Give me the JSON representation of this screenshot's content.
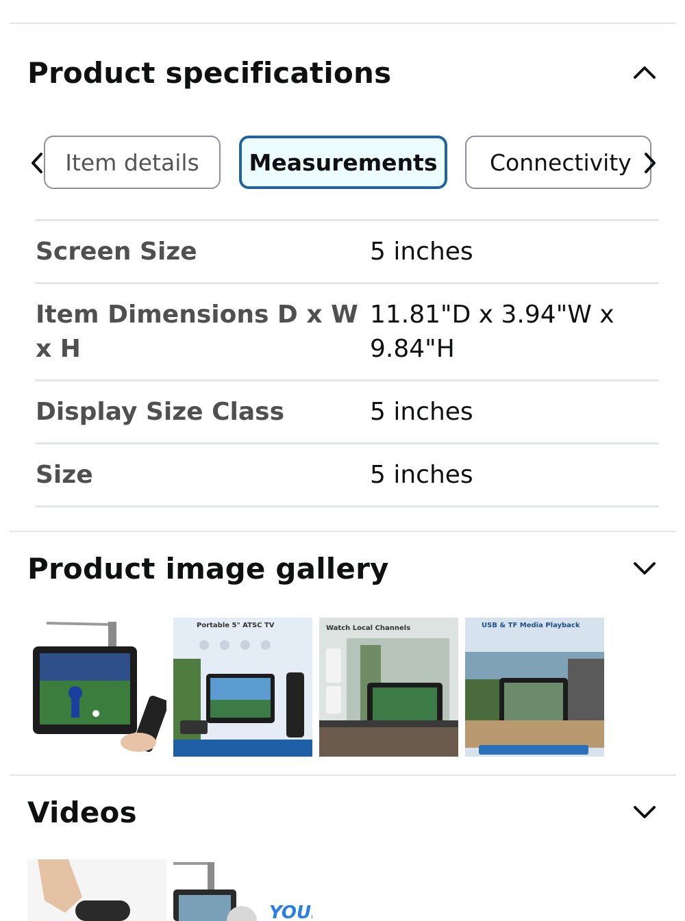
{
  "specs_section": {
    "title": "Product specifications",
    "expanded": true,
    "toggle_icon": "chevron-up-icon"
  },
  "tabs": {
    "prev_icon": "chevron-left-icon",
    "next_icon": "chevron-right-icon",
    "items": [
      {
        "label": "Item details",
        "active": false
      },
      {
        "label": "Measurements",
        "active": true
      },
      {
        "label": "Connectivity",
        "active": false
      }
    ]
  },
  "specs": [
    {
      "label": "Screen Size",
      "value": "5 inches"
    },
    {
      "label": "Item Dimensions D x W x H",
      "value": "11.81\"D x 3.94\"W x 9.84\"H"
    },
    {
      "label": "Display Size Class",
      "value": "5 inches"
    },
    {
      "label": "Size",
      "value": "5 inches"
    }
  ],
  "gallery_section": {
    "title": "Product image gallery",
    "expanded": false,
    "toggle_icon": "chevron-down-icon",
    "images": [
      {
        "caption": ""
      },
      {
        "caption": "Portable 5\" ATSC TV"
      },
      {
        "caption": "Watch Local Channels"
      },
      {
        "caption": "USB & TF Media Playback"
      }
    ]
  },
  "videos_section": {
    "title": "Videos",
    "expanded": false,
    "toggle_icon": "chevron-down-icon",
    "partial_text": "YOUR"
  },
  "colors": {
    "accent": "#2162a1",
    "active_tab_bg": "#edfdff",
    "divider": "#e3e6e6",
    "text": "#0f1111",
    "label": "#505050"
  }
}
